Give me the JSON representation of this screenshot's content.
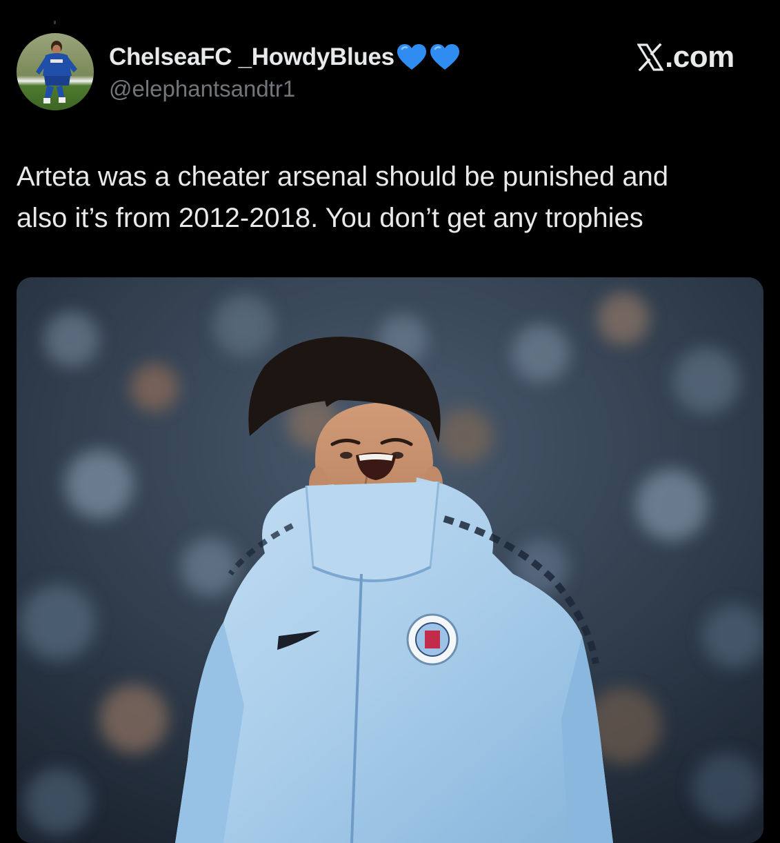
{
  "post": {
    "author": {
      "display_name": "ChelseaFC _HowdyBlues",
      "emoji": [
        "blue-heart",
        "blue-heart"
      ],
      "handle": "@elephantsandtr1",
      "avatar": "player-in-blue-kit-photo"
    },
    "source_label": ".com",
    "source_icon": "x-logo-icon",
    "text_lines": [
      "Arteta was a cheater arsenal should be punished and",
      "also it’s from 2012-2018. You don’t get any trophies"
    ],
    "media": {
      "kind": "photo",
      "subject": "man-in-light-blue-training-jacket"
    }
  },
  "colors": {
    "background": "#000000",
    "text_primary": "#e7e9ea",
    "text_secondary": "#71767b",
    "heart_blue": "#2f8cf0",
    "jacket_blue": "#a9cdea"
  }
}
